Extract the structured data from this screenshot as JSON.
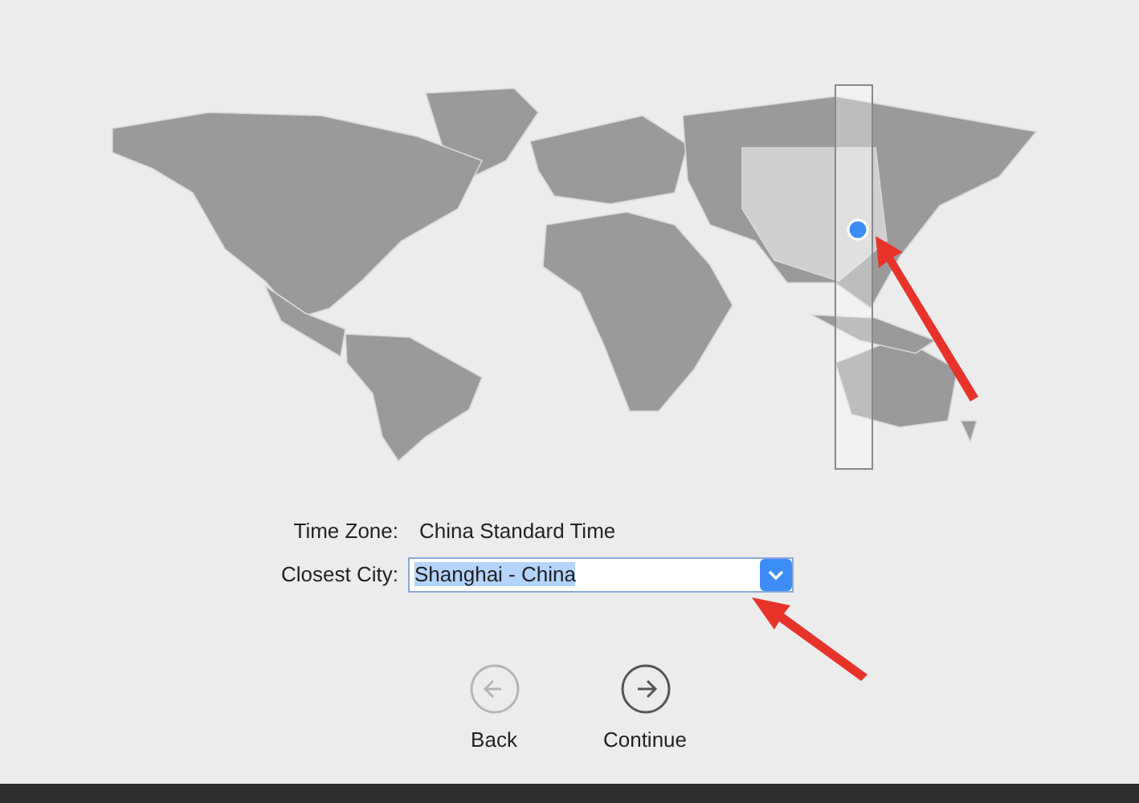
{
  "map": {
    "pin": true
  },
  "fields": [
    {
      "label": "Time Zone:",
      "kind": "text",
      "value": "China Standard Time"
    },
    {
      "label": "Closest City:",
      "kind": "select",
      "value": "Shanghai - China",
      "selected": true
    }
  ],
  "buttons": [
    {
      "label": "Back",
      "kind": "back",
      "disabled": true
    },
    {
      "label": "Continue",
      "kind": "forward",
      "disabled": false
    }
  ]
}
